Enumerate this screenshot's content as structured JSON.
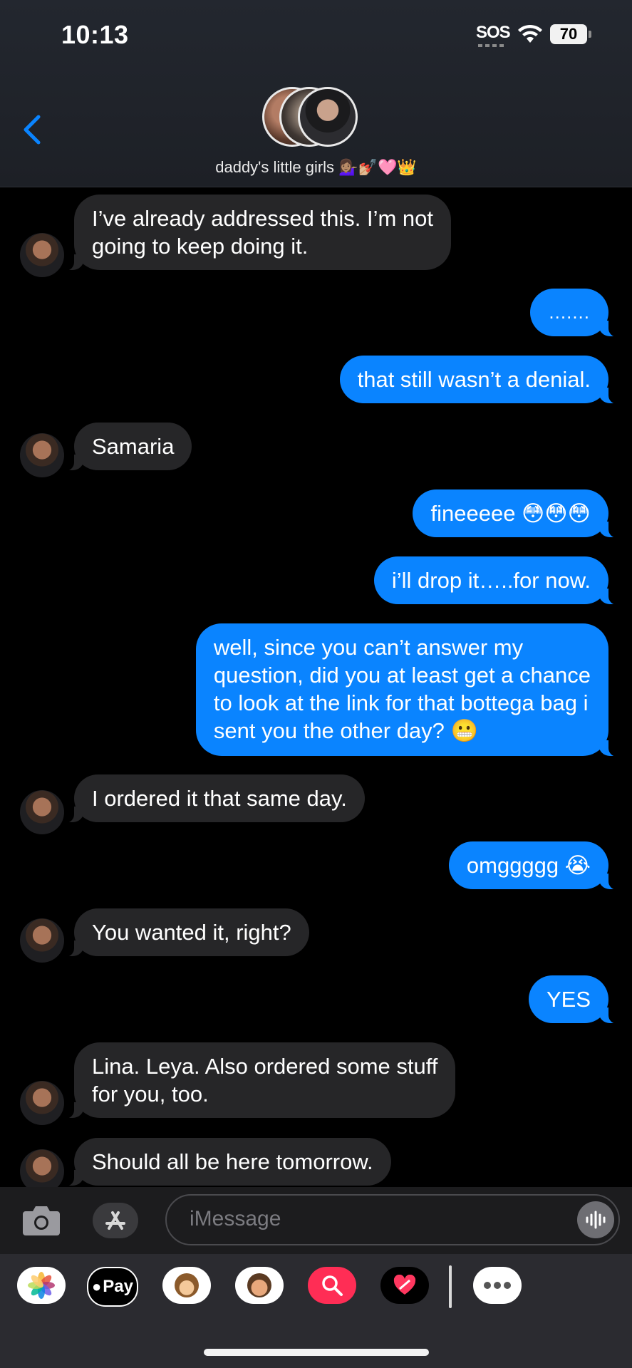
{
  "status_bar": {
    "time": "10:13",
    "sos": "SOS",
    "battery": "70"
  },
  "header": {
    "group_name": "daddy's little girls 💁🏽‍♀️💅🏼🩷👑"
  },
  "messages": [
    {
      "from": "them",
      "lines": [
        "I’ve already addressed this. I’m not",
        "going to keep doing it."
      ]
    },
    {
      "from": "me",
      "lines": [
        "......."
      ]
    },
    {
      "from": "me",
      "lines": [
        "that still wasn’t a denial."
      ]
    },
    {
      "from": "them",
      "lines": [
        "Samaria"
      ]
    },
    {
      "from": "me",
      "lines": [
        "fineeeee 😳😳😳"
      ]
    },
    {
      "from": "me",
      "lines": [
        "i’ll drop it…..for now."
      ]
    },
    {
      "from": "me",
      "lines": [
        "well, since you can’t answer my",
        "question, did you at least get a chance",
        "to look at the link for that bottega bag i",
        "sent you the other day? 😬"
      ]
    },
    {
      "from": "them",
      "lines": [
        "I ordered it that same day."
      ]
    },
    {
      "from": "me",
      "lines": [
        "omggggg 😭"
      ]
    },
    {
      "from": "them",
      "lines": [
        "You wanted it, right?"
      ]
    },
    {
      "from": "me",
      "lines": [
        "YES"
      ]
    },
    {
      "from": "them",
      "lines": [
        "Lina. Leya. Also ordered some stuff",
        "for you, too."
      ]
    },
    {
      "from": "them",
      "lines": [
        "Should all be here tomorrow."
      ]
    }
  ],
  "compose": {
    "placeholder": "iMessage"
  },
  "app_drawer": {
    "items": [
      {
        "icon": "photos-icon"
      },
      {
        "icon": "apple-pay-icon",
        "label": "Pay"
      },
      {
        "icon": "animoji-monkey-icon"
      },
      {
        "icon": "memoji-icon"
      },
      {
        "icon": "image-search-icon"
      },
      {
        "icon": "digital-touch-heart-icon"
      },
      {
        "icon": "more-icon"
      }
    ]
  },
  "colors": {
    "outgoing": "#0a84ff",
    "incoming": "#262628",
    "accent": "#0a84ff"
  }
}
